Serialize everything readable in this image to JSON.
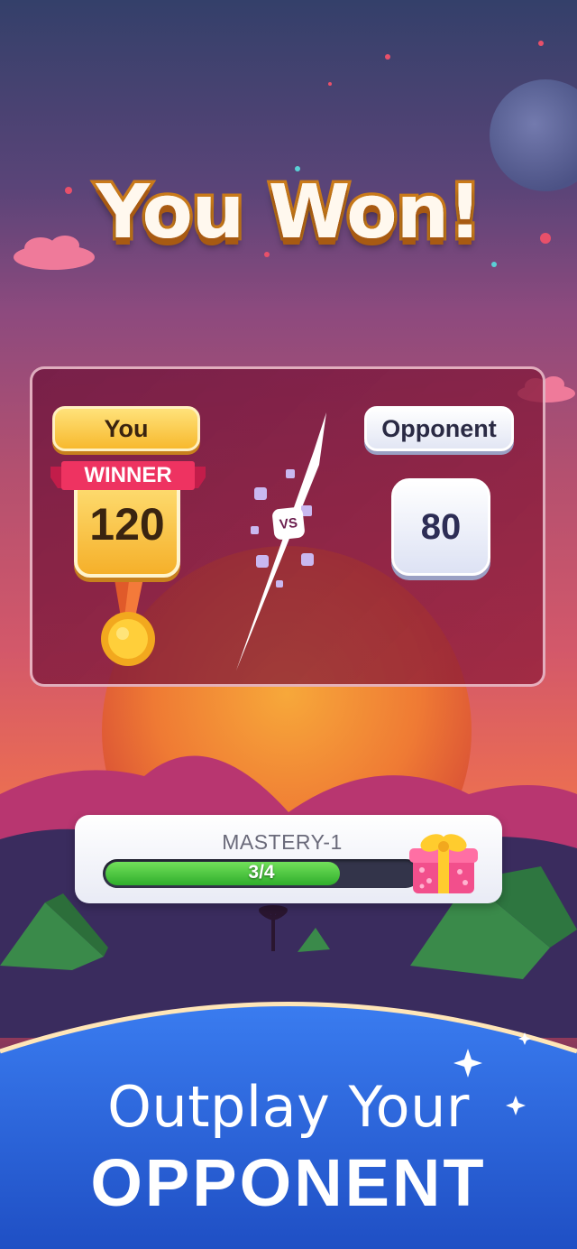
{
  "header": {
    "title": "You Won!"
  },
  "match": {
    "player": {
      "label": "You",
      "badge": "WINNER",
      "score": "120"
    },
    "vs_label": "VS",
    "opponent": {
      "label": "Opponent",
      "score": "80"
    }
  },
  "mastery": {
    "label": "MASTERY-1",
    "progress_text": "3/4",
    "progress_fraction": 0.75
  },
  "promo": {
    "line1": "Outplay Your",
    "line2": "OPPONENT"
  },
  "colors": {
    "title_outline": "#c97a1a",
    "gold": "#f7b92e",
    "progress_green": "#3dbb33",
    "planet_blue": "#2e6fe0"
  }
}
